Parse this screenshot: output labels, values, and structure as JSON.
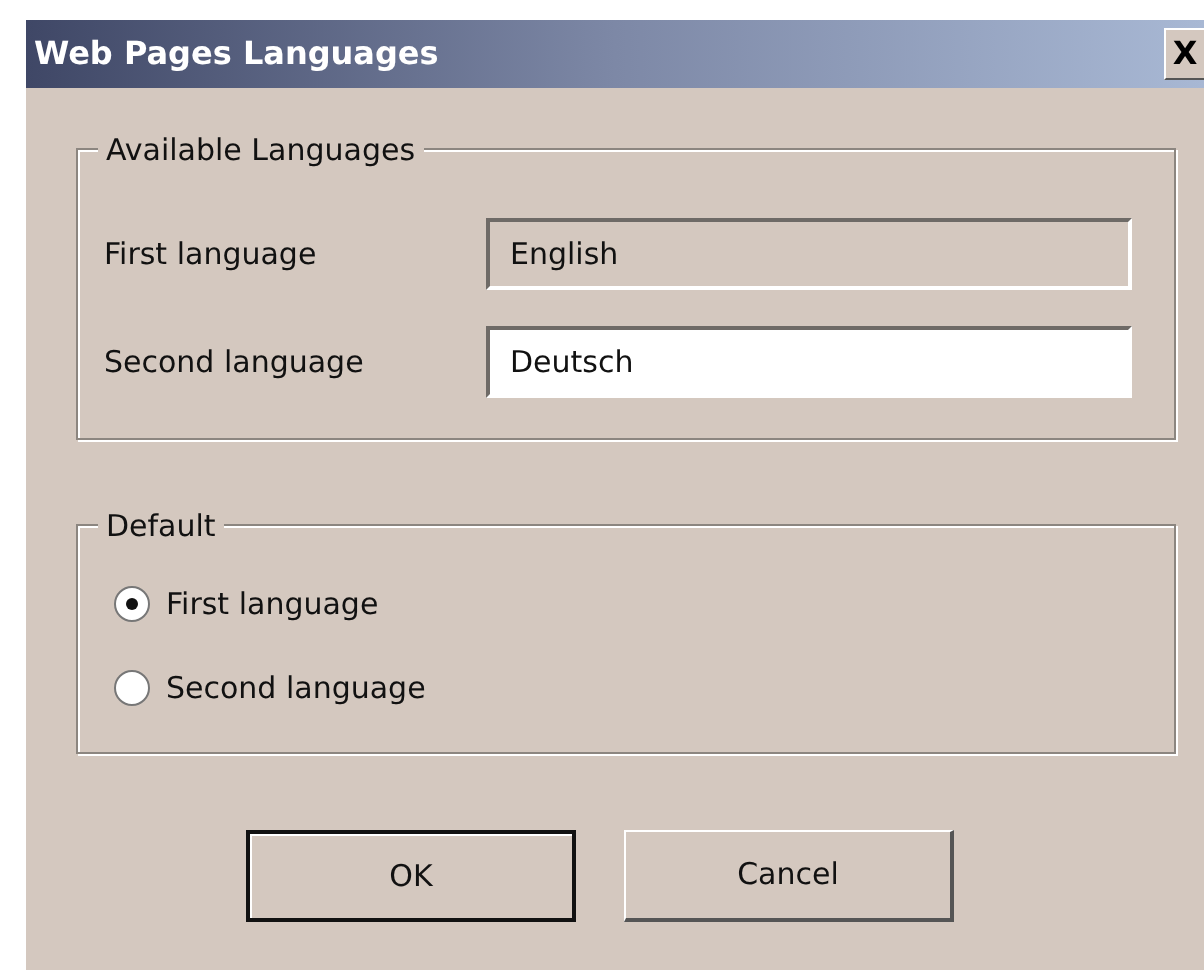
{
  "window": {
    "title": "Web Pages Languages",
    "close_button": "X"
  },
  "available_languages": {
    "legend": "Available Languages",
    "fields": [
      {
        "label": "First language",
        "value": "English",
        "disabled": true
      },
      {
        "label": "Second language",
        "value": "Deutsch",
        "disabled": false
      }
    ]
  },
  "default": {
    "legend": "Default",
    "options": [
      {
        "label": "First language",
        "selected": true
      },
      {
        "label": "Second language",
        "selected": false
      }
    ]
  },
  "buttons": [
    {
      "label": "OK",
      "default": true
    },
    {
      "label": "Cancel",
      "default": false
    }
  ]
}
